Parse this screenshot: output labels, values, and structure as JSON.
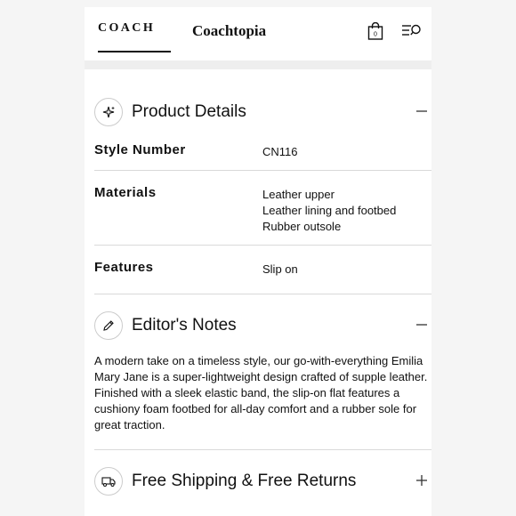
{
  "header": {
    "brand": "COACH",
    "sub_brand": "Coachtopia",
    "bag_count": "0",
    "icons": [
      "shopping-bag-icon",
      "menu-search-icon"
    ]
  },
  "product_details": {
    "title": "Product Details",
    "icon": "sparkle-icon",
    "toggle": "minus",
    "rows": [
      {
        "label": "Style Number",
        "values": [
          "CN116"
        ]
      },
      {
        "label": "Materials",
        "values": [
          "Leather upper",
          "Leather lining and footbed",
          "Rubber outsole"
        ]
      },
      {
        "label": "Features",
        "values": [
          "Slip on"
        ]
      }
    ]
  },
  "editors_notes": {
    "title": "Editor's Notes",
    "icon": "pencil-icon",
    "toggle": "minus",
    "text": "A modern take on a timeless style, our go-with-everything Emilia Mary Jane is a super-lightweight design crafted of supple leather. Finished with a sleek elastic band, the slip-on flat features a cushiony foam footbed for all-day comfort and a rubber sole for great traction."
  },
  "shipping": {
    "title": "Free Shipping & Free Returns",
    "icon": "truck-icon",
    "toggle": "plus"
  }
}
